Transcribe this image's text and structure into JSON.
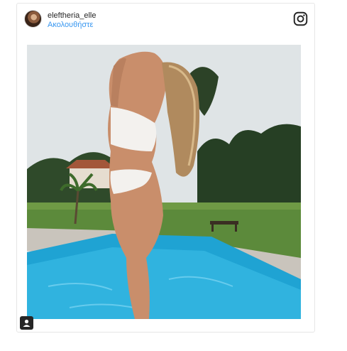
{
  "post": {
    "username": "eleftheria_elle",
    "follow_label": "Ακολουθήστε",
    "platform_icon": "instagram-icon",
    "photo_description_icon": "post-photo",
    "profile_icon": "profile-badge-icon"
  },
  "colors": {
    "follow": "#3897f0",
    "text": "#262626",
    "border": "#e6e6e6",
    "pool": "#2aa8d6",
    "sky": "#dde3e6"
  }
}
